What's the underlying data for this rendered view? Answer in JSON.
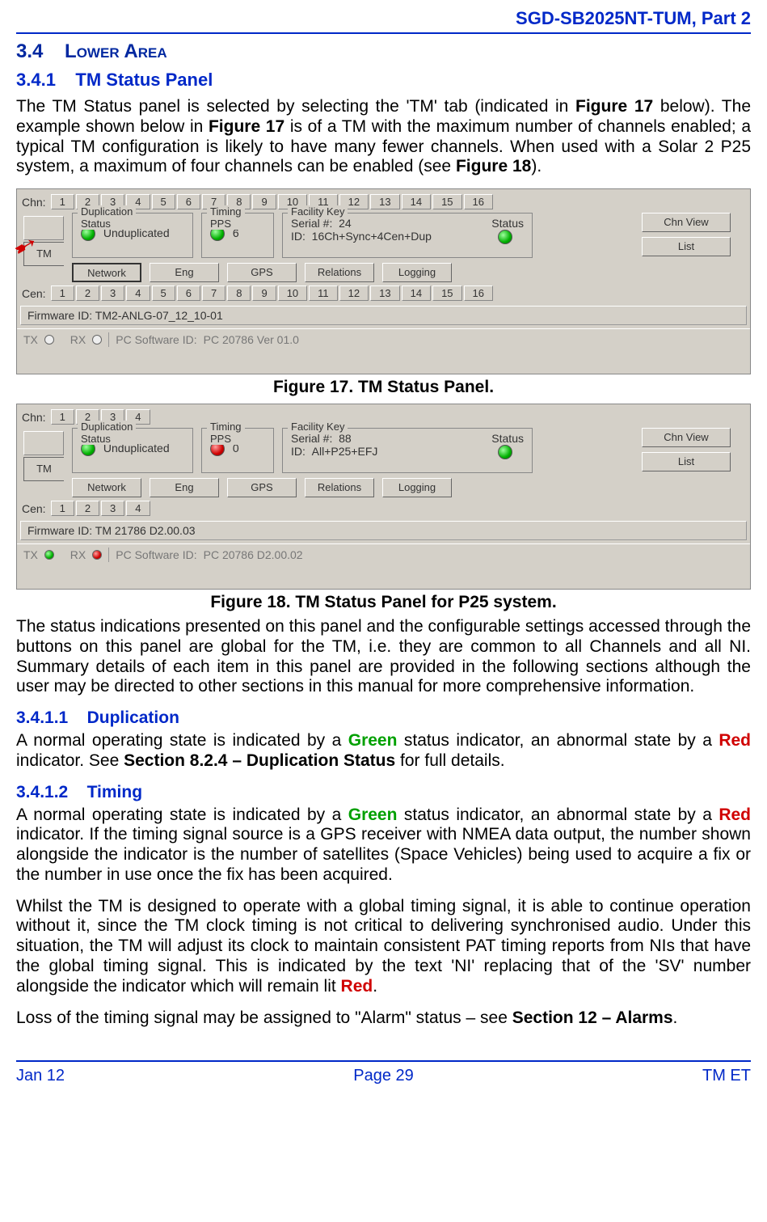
{
  "header": {
    "doc_id": "SGD-SB2025NT-TUM, Part 2"
  },
  "headings": {
    "h2_num": "3.4",
    "h2_title": "Lower Area",
    "h3_num": "3.4.1",
    "h3_title": "TM Status Panel",
    "h4a_num": "3.4.1.1",
    "h4a_title": "Duplication",
    "h4b_num": "3.4.1.2",
    "h4b_title": "Timing"
  },
  "para1": {
    "t1": "The TM Status panel is selected by selecting the 'TM' tab (indicated in ",
    "b1": "Figure 17",
    "t2": " below).  The example shown below in ",
    "b2": "Figure 17",
    "t3": " is of a TM with the maximum number of channels enabled; a typical TM configuration is likely to have many fewer channels.  When used with a Solar 2 P25 system, a maximum of four channels can be enabled (see ",
    "b3": "Figure 18",
    "t4": ")."
  },
  "fig17_caption": "Figure 17.  TM Status Panel.",
  "fig18_caption": "Figure 18.  TM Status Panel for P25 system.",
  "para2": "The status indications presented on this panel and the configurable settings accessed through the buttons on this panel are global for the TM, i.e. they are common to all Channels and all NI. Summary details of each item in this panel are provided in the following sections although the user may be directed to other sections in this manual for more comprehensive information.",
  "para3": {
    "t1": "A normal operating state is indicated by a ",
    "g1": "Green",
    "t2": " status indicator, an abnormal state by a ",
    "r1": "Red",
    "t3": " indicator.  See ",
    "b1": "Section 8.2.4 – Duplication Status",
    "t4": " for full details."
  },
  "para4": {
    "t1": "A normal operating state is indicated by a ",
    "g1": "Green",
    "t2": " status indicator, an abnormal state by a ",
    "r1": "Red",
    "t3": " indicator.  If the timing signal source is a GPS receiver with NMEA data output, the number shown alongside the indicator is the number of satellites (Space Vehicles) being used to acquire a fix or the number in use once the fix has been acquired."
  },
  "para5": {
    "t1": "Whilst the TM is designed to operate with a global timing signal, it is able to continue operation without it, since the TM clock timing is not critical to delivering synchronised audio.  Under this situation, the TM will adjust its clock to maintain consistent PAT timing reports from NIs that have the global timing signal.  This is indicated by the text 'NI' replacing that of the 'SV' number alongside the indicator which will remain lit ",
    "r1": "Red",
    "t2": "."
  },
  "para6": {
    "t1": "Loss of the timing signal may be assigned to \"Alarm\" status – see ",
    "b1": "Section 12 – Alarms",
    "t2": "."
  },
  "fig17": {
    "chn_label": "Chn:",
    "cen_label": "Cen:",
    "channels": [
      "1",
      "2",
      "3",
      "4",
      "5",
      "6",
      "7",
      "8",
      "9",
      "10",
      "11",
      "12",
      "13",
      "14",
      "15",
      "16"
    ],
    "tab_blank": " ",
    "tab_tm": "TM",
    "dup_title": "Duplication",
    "dup_sub": "Status",
    "dup_text": "Unduplicated",
    "tim_title": "Timing",
    "tim_sub": "PPS",
    "tim_val": "6",
    "fac_title": "Facility Key",
    "fac_serial_lbl": "Serial #:",
    "fac_serial_val": "24",
    "fac_id_lbl": "ID:",
    "fac_id_val": "16Ch+Sync+4Cen+Dup",
    "fac_status_lbl": "Status",
    "btn_chnview": "Chn View",
    "btn_list": "List",
    "btn_network": "Network",
    "btn_eng": "Eng",
    "btn_gps": "GPS",
    "btn_relations": "Relations",
    "btn_logging": "Logging",
    "firmware_lbl": "Firmware ID:",
    "firmware_val": "TM2-ANLG-07_12_10-01",
    "tx": "TX",
    "rx": "RX",
    "pcsw_lbl": "PC Software ID:",
    "pcsw_val": "PC 20786  Ver 01.0"
  },
  "fig18": {
    "chn_label": "Chn:",
    "cen_label": "Cen:",
    "channels": [
      "1",
      "2",
      "3",
      "4"
    ],
    "tab_blank": " ",
    "tab_tm": "TM",
    "dup_title": "Duplication",
    "dup_sub": "Status",
    "dup_text": "Unduplicated",
    "tim_title": "Timing",
    "tim_sub": "PPS",
    "tim_val": "0",
    "fac_title": "Facility Key",
    "fac_serial_lbl": "Serial #:",
    "fac_serial_val": "88",
    "fac_id_lbl": "ID:",
    "fac_id_val": "All+P25+EFJ",
    "fac_status_lbl": "Status",
    "btn_chnview": "Chn View",
    "btn_list": "List",
    "btn_network": "Network",
    "btn_eng": "Eng",
    "btn_gps": "GPS",
    "btn_relations": "Relations",
    "btn_logging": "Logging",
    "firmware_lbl": "Firmware ID:",
    "firmware_val": "TM 21786 D2.00.03",
    "tx": "TX",
    "rx": "RX",
    "pcsw_lbl": "PC Software ID:",
    "pcsw_val": "PC 20786 D2.00.02"
  },
  "footer": {
    "left": "Jan 12",
    "center": "Page 29",
    "right": "TM ET"
  }
}
